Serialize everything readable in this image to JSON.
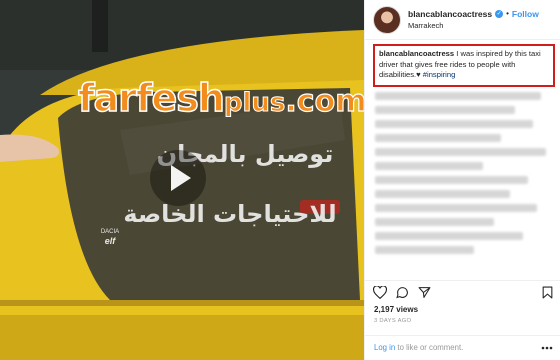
{
  "post": {
    "username": "blancablancoactress",
    "verified_icon": "verified-badge-icon",
    "separator": "•",
    "follow_label": "Follow",
    "location": "Marrakech"
  },
  "caption": {
    "username": "blancablancoactress",
    "text": "I was inspired by this taxi driver that gives free rides to people with disabilities.",
    "heart": "♥",
    "hashtag": "#inspiring"
  },
  "media": {
    "watermark_main": "farfesh",
    "watermark_plus": "plus",
    "watermark_com": ".com",
    "car_badge_1": "DACIA",
    "car_badge_2": "elf",
    "window_text_line1": "توصيل بالمجان",
    "window_text_line2": "للاحتياجات الخاصة",
    "play_icon": "play-icon"
  },
  "stats": {
    "views": "2,197 views",
    "time_ago": "3 days ago"
  },
  "footer": {
    "login_link": "Log in",
    "login_rest": " to like or comment."
  },
  "colors": {
    "accent": "#3897f0",
    "highlight_border": "#d21d1d",
    "taxi_yellow": "#e8c21e",
    "watermark_orange": "#f28c1c"
  }
}
